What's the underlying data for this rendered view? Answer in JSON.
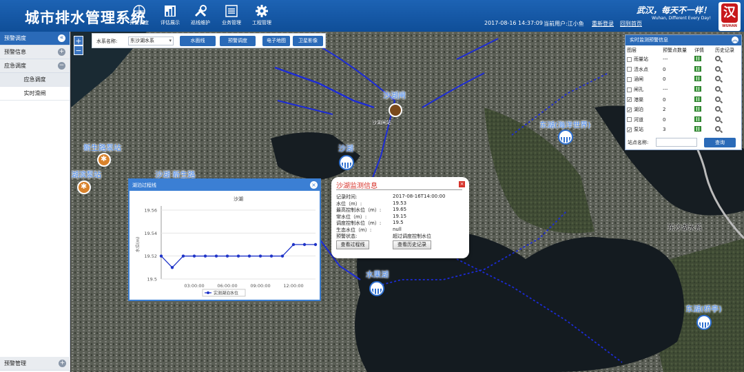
{
  "header": {
    "title": "城市排水管理系统",
    "nav": [
      {
        "label": "预警调度",
        "icon": "compass-icon"
      },
      {
        "label": "评估展示",
        "icon": "bar-chart-icon"
      },
      {
        "label": "巡线维护",
        "icon": "tools-icon"
      },
      {
        "label": "业务管理",
        "icon": "list-icon"
      },
      {
        "label": "工程管理",
        "icon": "gear-icon"
      }
    ],
    "datetime": "2017-08-16 14:37:09",
    "user": "当前用户:江小鱼",
    "relogin": "重新登录",
    "home": "回到首页",
    "slogan_cn": "武汉，每天不一样！",
    "slogan_en": "Wuhan, Different Every Day!",
    "logo_text": "WUHAN"
  },
  "sidebar": {
    "title": "预警调度",
    "sections": [
      {
        "label": "预警信息",
        "toggle": "+"
      },
      {
        "label": "应急调度",
        "toggle": "−"
      }
    ],
    "sub_items": [
      "应急调度",
      "实时滑闸"
    ],
    "bottom": {
      "label": "预警管理",
      "toggle": "+"
    }
  },
  "toolbar": {
    "water_system_label": "水系名称:",
    "water_system_value": "东沙湖水系",
    "buttons": [
      "水面线",
      "预警调度"
    ],
    "map_types": [
      "电子地图",
      "卫星影像"
    ]
  },
  "map": {
    "zoom_in": "+",
    "zoom_out": "−",
    "labels": {
      "shahu_gate": "沙湖闸",
      "shahu": "沙湖",
      "donghu_haiyang": "东湖(海洋世界)",
      "xinshengling": "新生路泵站",
      "tiyan": "湖滨泵站",
      "shahu_xinsheng": "沙湖 新生路",
      "shuiguohu": "水果湖",
      "dongshahu_system": "东沙湖水系",
      "donghu_qiaoting": "东湖(桥亭)",
      "small_tag": "沙湖闸站"
    }
  },
  "rt_panel": {
    "title": "实时监测预警信息",
    "columns": [
      "图层",
      "预警点数量",
      "详情",
      "历史记录"
    ],
    "rows": [
      {
        "name": "雨量站",
        "checked": false,
        "count": "---"
      },
      {
        "name": "渍水点",
        "checked": false,
        "count": "0"
      },
      {
        "name": "涵闸",
        "checked": false,
        "count": "0"
      },
      {
        "name": "闸孔",
        "checked": false,
        "count": "---"
      },
      {
        "name": "港渠",
        "checked": true,
        "count": "0"
      },
      {
        "name": "湖泊",
        "checked": true,
        "count": "2"
      },
      {
        "name": "河道",
        "checked": false,
        "count": "0"
      },
      {
        "name": "泵站",
        "checked": true,
        "count": "3"
      }
    ],
    "station_label": "站点名称:",
    "query": "查询"
  },
  "chart_window": {
    "title": "湖泊过程线",
    "close": "×"
  },
  "chart_data": {
    "type": "line",
    "title": "沙湖",
    "ylabel": "水位(m)",
    "xlabel": "",
    "ylim": [
      19.5,
      19.56
    ],
    "yticks": [
      19.5,
      19.52,
      19.54,
      19.56
    ],
    "xticks": [
      "03:00:00",
      "06:00:00",
      "09:00:00",
      "12:00:00"
    ],
    "x_hours": [
      0,
      1,
      2,
      3,
      4,
      5,
      6,
      7,
      8,
      9,
      10,
      11,
      12,
      13,
      14
    ],
    "series": [
      {
        "name": "实测湖泊水位",
        "color": "#1f34c8",
        "values": [
          19.52,
          19.51,
          19.52,
          19.52,
          19.52,
          19.52,
          19.52,
          19.52,
          19.52,
          19.52,
          19.52,
          19.52,
          19.53,
          19.53,
          19.53
        ]
      }
    ],
    "legend_position": "bottom"
  },
  "info_popup": {
    "title": "沙湖监测信息",
    "rows": [
      {
        "k": "记录时间:",
        "v": "2017-08-16T14:00:00"
      },
      {
        "k": "水位（m）:",
        "v": "19.53"
      },
      {
        "k": "最高控制水位（m）:",
        "v": "19.65"
      },
      {
        "k": "常水位（m）:",
        "v": "19.15"
      },
      {
        "k": "调度控制水位（m）:",
        "v": "19.5"
      },
      {
        "k": "生态水位（m）:",
        "v": "null"
      },
      {
        "k": "预警状态:",
        "v": "超过调度控制水位"
      }
    ],
    "btn_curve": "查看过程线",
    "btn_history": "查看历史记录",
    "close": "×"
  }
}
